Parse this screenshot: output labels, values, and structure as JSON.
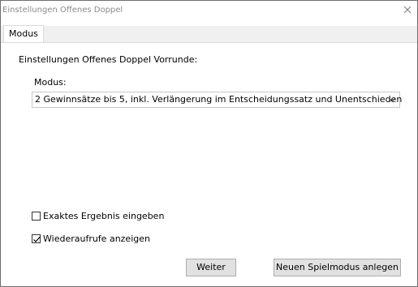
{
  "window": {
    "title": "Einstellungen Offenes Doppel"
  },
  "tabs": [
    {
      "label": "Modus",
      "selected": true
    }
  ],
  "section": {
    "title": "Einstellungen Offenes Doppel Vorrunde:",
    "mode_label": "Modus:",
    "mode_value": "2 Gewinnsätze bis 5, inkl. Verlängerung im Entscheidungssatz und Unentschieden"
  },
  "options": {
    "exact_result_label": "Exaktes Ergebnis eingeben",
    "exact_result_checked": false,
    "show_recalls_label": "Wiederaufrufe anzeigen",
    "show_recalls_checked": true
  },
  "buttons": {
    "next_label": "Weiter",
    "new_mode_label": "Neuen Spielmodus anlegen"
  },
  "icons": {
    "close": "close-icon",
    "dropdown": "chevron-down-icon",
    "check": "checkmark-icon"
  }
}
